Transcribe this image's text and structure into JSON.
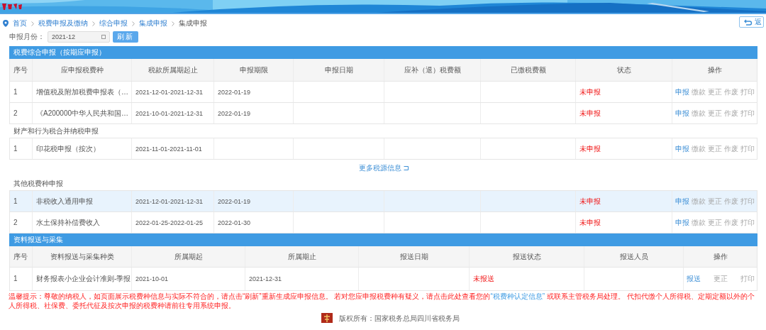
{
  "breadcrumb": [
    {
      "label": "首页",
      "current": false
    },
    {
      "label": "税费申报及缴纳",
      "current": false
    },
    {
      "label": "综合申报",
      "current": false
    },
    {
      "label": "集成申报",
      "current": false
    },
    {
      "label": "集成申报",
      "current": true
    }
  ],
  "back_button": {
    "label": "返"
  },
  "filter": {
    "label": "申报月份：",
    "value": "2021-12",
    "button": "刷新"
  },
  "declaration_panel": {
    "title": "税费综合申报（按期应申报）",
    "columns": [
      "序号",
      "应申报税费种",
      "税款所属期起止",
      "申报期限",
      "申报日期",
      "应补（退）税费额",
      "已缴税费额",
      "状态",
      "操作"
    ],
    "blocks": [
      {
        "kind": "rows",
        "rows": [
          {
            "no": "1",
            "item": "增值税及附加税费申报表（…",
            "period": "2021-12-01-2021-12-31",
            "deadline": "2022-01-19",
            "status": "未申报",
            "selected": false,
            "actions": [
              {
                "label": "申报",
                "disabled": false
              },
              {
                "label": "缴款",
                "disabled": true
              },
              {
                "label": "更正",
                "disabled": true
              },
              {
                "label": "作废",
                "disabled": true
              },
              {
                "label": "打印",
                "disabled": true
              }
            ]
          },
          {
            "no": "2",
            "item": "《A200000中华人民共和国…",
            "period": "2021-10-01-2021-12-31",
            "deadline": "2022-01-19",
            "status": "未申报",
            "selected": false,
            "actions": [
              {
                "label": "申报",
                "disabled": false
              },
              {
                "label": "缴款",
                "disabled": true
              },
              {
                "label": "更正",
                "disabled": true
              },
              {
                "label": "作废",
                "disabled": true
              },
              {
                "label": "打印",
                "disabled": true
              }
            ]
          }
        ]
      },
      {
        "kind": "heading",
        "text": "财产和行为税合并纳税申报"
      },
      {
        "kind": "rows",
        "rows": [
          {
            "no": "1",
            "item": "印花税申报（按次）",
            "period": "2021-11-01-2021-11-01",
            "status": "未申报",
            "selected": false,
            "actions": [
              {
                "label": "申报",
                "disabled": false
              },
              {
                "label": "缴款",
                "disabled": true
              },
              {
                "label": "更正",
                "disabled": true
              },
              {
                "label": "作废",
                "disabled": true
              },
              {
                "label": "打印",
                "disabled": true
              }
            ]
          }
        ]
      },
      {
        "kind": "link",
        "text": "更多税源信息"
      },
      {
        "kind": "heading",
        "text": "其他税费种申报"
      },
      {
        "kind": "rows",
        "rows": [
          {
            "no": "1",
            "item": "非税收入通用申报",
            "period": "2021-12-01-2021-12-31",
            "deadline": "2022-01-19",
            "status": "未申报",
            "selected": true,
            "actions": [
              {
                "label": "申报",
                "disabled": false
              },
              {
                "label": "缴款",
                "disabled": true
              },
              {
                "label": "更正",
                "disabled": true
              },
              {
                "label": "作废",
                "disabled": true
              },
              {
                "label": "打印",
                "disabled": true
              }
            ]
          },
          {
            "no": "2",
            "item": "水土保持补偿费收入",
            "period": "2022-01-25-2022-01-25",
            "deadline": "2022-01-30",
            "status": "未申报",
            "selected": false,
            "actions": [
              {
                "label": "申报",
                "disabled": false
              },
              {
                "label": "缴款",
                "disabled": true
              },
              {
                "label": "更正",
                "disabled": true
              },
              {
                "label": "作废",
                "disabled": true
              },
              {
                "label": "打印",
                "disabled": true
              }
            ]
          }
        ]
      }
    ]
  },
  "submission_panel": {
    "title": "资料报送与采集",
    "columns": [
      "序号",
      "资料报送与采集种类",
      "所属期起",
      "所属期止",
      "报送日期",
      "报送状态",
      "报送人员",
      "操作"
    ],
    "rows": [
      {
        "no": "1",
        "item": "财务报表小企业会计准则-季报",
        "start": "2021-10-01",
        "end": "2021-12-31",
        "status": "未报送",
        "actions": [
          {
            "label": "报送",
            "disabled": false
          },
          {
            "label": "更正",
            "disabled": true
          },
          {
            "label": "打印",
            "disabled": true
          }
        ]
      }
    ]
  },
  "notice": {
    "before": "温馨提示：尊敬的纳税人，如页面展示税费种信息与实际不符合的，请点击“刷新”重新生成应申报信息。 若对您应申报税费种有疑义，请点击此处查看您的",
    "link": "“税费种认定信息”",
    "after": " 或联系主管税务局处理。 代扣代缴个人所得税、定期定额以外的个人所得税、社保费、委托代征及按次申报的税费种请前往专用系统申报。"
  },
  "footer": {
    "copyright": "版权所有：国家税务总局四川省税务局"
  }
}
